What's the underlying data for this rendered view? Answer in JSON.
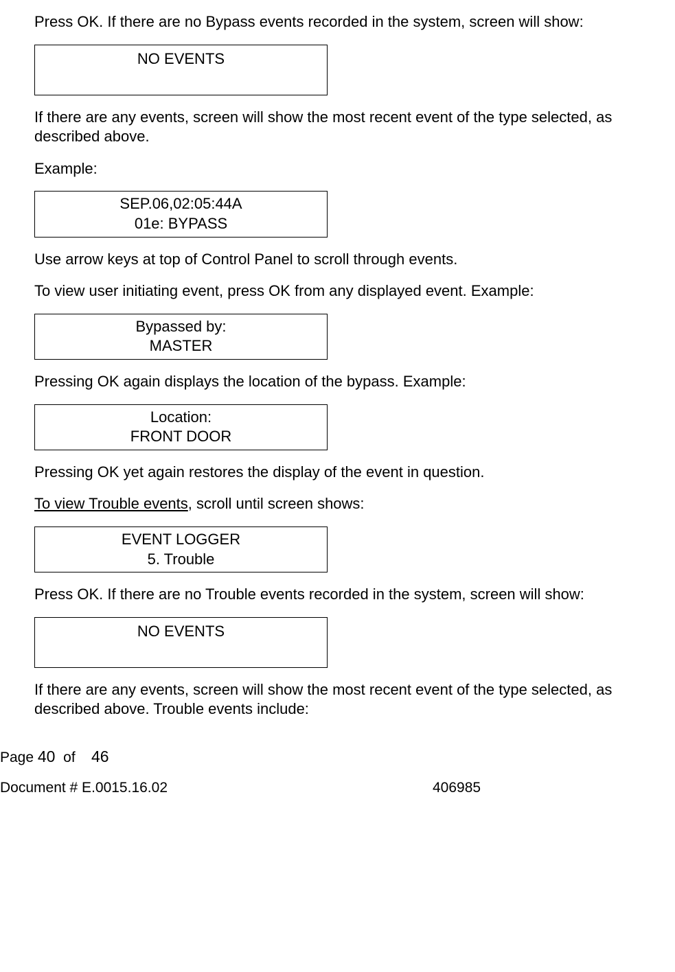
{
  "p1": "Press OK. If there are no Bypass events recorded in the system, screen will show:",
  "box1_line1": "NO EVENTS",
  "p2": "If there are any events, screen will show the most recent event of the type selected, as described above.",
  "p3": "Example:",
  "box2_line1": "SEP.06,02:05:44A",
  "box2_line2": "01e: BYPASS",
  "p4": "Use arrow keys at top of Control Panel to scroll through events.",
  "p5": "To view user initiating event, press OK from any displayed event. Example:",
  "box3_line1": "Bypassed by:",
  "box3_line2": "MASTER",
  "p6": "Pressing OK again displays the location of the bypass. Example:",
  "box4_line1": "Location:",
  "box4_line2": "FRONT DOOR",
  "p7": "Pressing OK yet again restores the display of the event in question.",
  "p8_underline": "To view Trouble events",
  "p8_rest": ", scroll until screen shows:",
  "box5_line1": "EVENT LOGGER",
  "box5_line2": "5. Trouble",
  "p9": "Press OK. If there are no Trouble events recorded in the system, screen will show:",
  "box6_line1": "NO EVENTS",
  "p10": "If there are any events, screen will show the most recent event of the type selected, as described above. Trouble events include:",
  "footer": {
    "page_label": "Page",
    "page_current": "40",
    "of": "of",
    "page_total": "46",
    "doc_label": "Document # E.0015.16.02",
    "doc_number": "406985"
  }
}
